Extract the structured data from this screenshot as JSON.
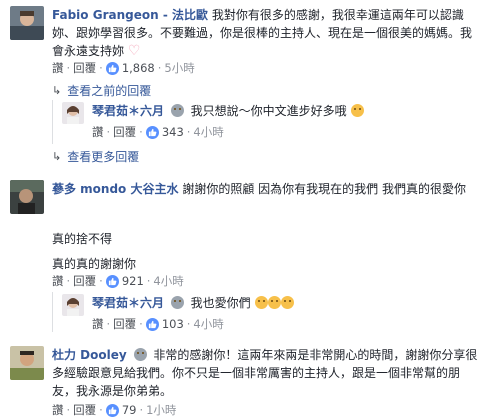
{
  "comments": [
    {
      "author": "Fabio Grangeon - 法比歐",
      "text": "我對你有很多的感謝，我很幸運這兩年可以認識妳、跟妳學習很多。不要難過，你是很棒的主持人、現在是一個很美的媽媽。我會永遠支持妳",
      "like_label": "讚",
      "reply_label": "回覆",
      "likes": "1,868",
      "time": "5小時"
    }
  ],
  "view_previous": "查看之前的回覆",
  "reply1": {
    "author": "琴君茹＊六月",
    "text": "我只想說～你中文進步好多哦",
    "like_label": "讚",
    "reply_label": "回覆",
    "likes": "343",
    "time": "4小時"
  },
  "view_more": "查看更多回覆",
  "comment2": {
    "author": "蔘多 mondo 大谷主水",
    "text_line1": "謝謝你的照顧 因為你有我現在的我們 我們真的很愛你",
    "text_line2": "真的捨不得",
    "text_line3": "真的真的謝謝你",
    "like_label": "讚",
    "reply_label": "回覆",
    "likes": "921",
    "time": "4小時"
  },
  "reply2": {
    "author": "琴君茹＊六月",
    "text": "我也愛你們",
    "like_label": "讚",
    "reply_label": "回覆",
    "likes": "103",
    "time": "4小時"
  },
  "comment3": {
    "author": "杜力 Dooley",
    "text": "非常的感謝你！這兩年來兩是非常開心的時間，謝謝你分享很多經驗跟意見給我們。你不只是一個非常厲害的主持人，跟是一個非常幫的朋友，我永源是你弟弟。",
    "like_label": "讚",
    "reply_label": "回覆",
    "likes": "79",
    "time": "1小時"
  },
  "icons": {
    "like": "thumbs-up-icon",
    "arrow": "reply-arrow-icon"
  },
  "colors": {
    "author": "#365899",
    "like_bubble": "#5890ff",
    "meta": "#90949c"
  }
}
